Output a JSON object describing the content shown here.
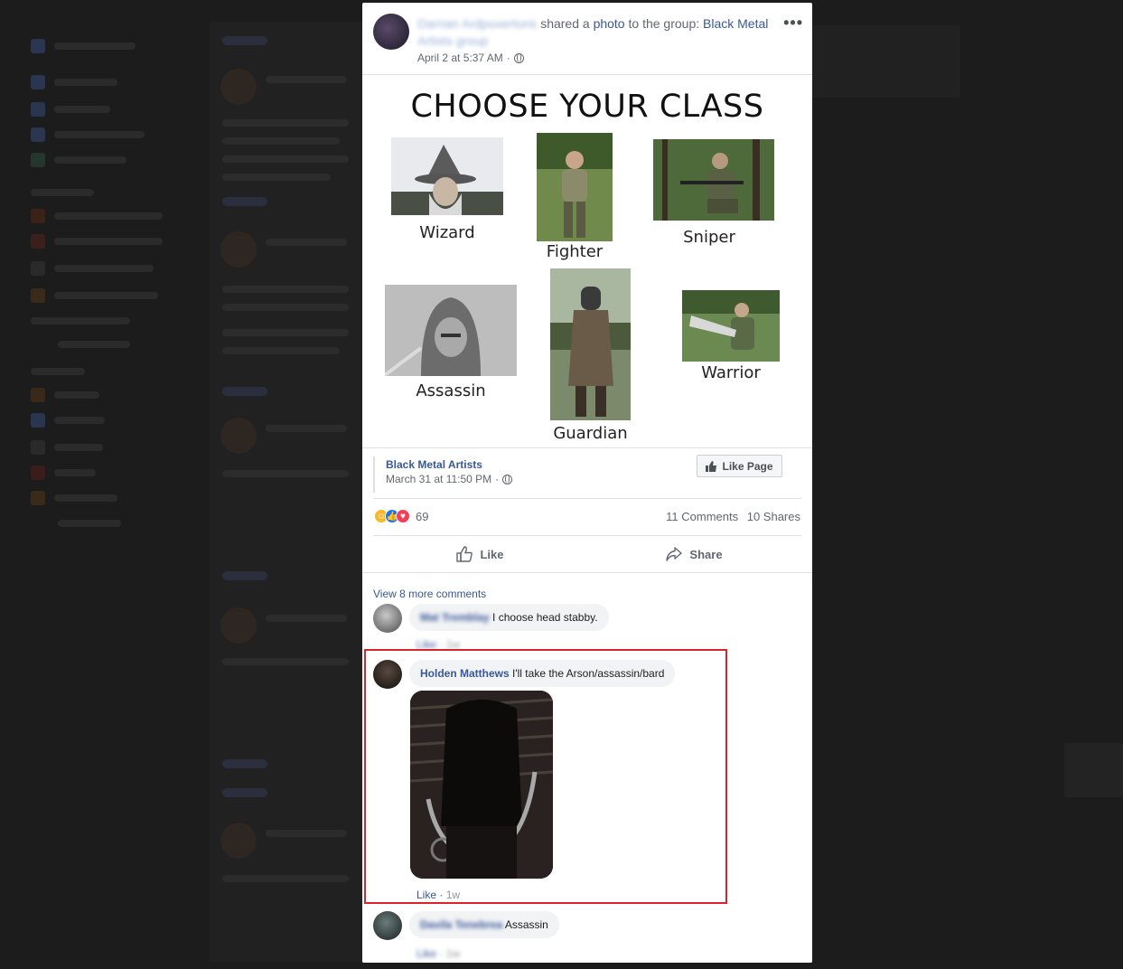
{
  "post": {
    "poster_name": "Darrian Ardpoxertons",
    "shared_text": "shared a",
    "photo_link": "photo",
    "to_group_text": "to the group:",
    "group_name": "Black Metal Artists group",
    "timestamp": "April 2 at 5:37 AM",
    "more_icon": "•••"
  },
  "image": {
    "title": "CHOOSE YOUR CLASS",
    "classes": [
      "Wizard",
      "Fighter",
      "Sniper",
      "Assassin",
      "Guardian",
      "Warrior"
    ]
  },
  "source": {
    "page_name": "Black Metal Artists",
    "date": "March 31 at 11:50 PM",
    "like_page_label": "Like Page"
  },
  "stats": {
    "reaction_count": "69",
    "comments": "11 Comments",
    "shares": "10 Shares"
  },
  "actions": {
    "like": "Like",
    "share": "Share"
  },
  "comments": {
    "view_more": "View 8 more comments",
    "list": [
      {
        "author": "Mat Tremblay",
        "text": "I choose head stabby.",
        "like": "Like",
        "time": "1w"
      },
      {
        "author": "Holden Matthews",
        "text": "I'll take the Arson/assassin/bard",
        "like": "Like",
        "time": "1w"
      },
      {
        "author": "Davila Tenebrea",
        "text": "Assassin",
        "like": "Like",
        "time": "1w"
      }
    ]
  },
  "colors": {
    "link": "#385898",
    "highlight": "#d8242b",
    "reaction_like": "#1877f2",
    "reaction_love": "#f33e58",
    "reaction_haha": "#f7b928"
  }
}
